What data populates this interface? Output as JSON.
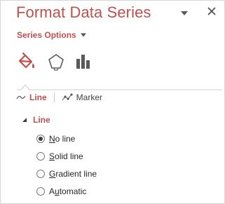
{
  "pane": {
    "title": "Format Data Series",
    "dropdown_icon": "chevron-down-icon",
    "close_icon": "close-icon"
  },
  "series_options": {
    "label": "Series Options",
    "caret_icon": "caret-down-icon"
  },
  "category_icons": [
    {
      "name": "fill-line",
      "icon": "paint-bucket-icon",
      "selected": true
    },
    {
      "name": "effects",
      "icon": "pentagon-icon",
      "selected": false
    },
    {
      "name": "series-options",
      "icon": "bar-chart-icon",
      "selected": false
    }
  ],
  "subtabs": {
    "line_label": "Line",
    "line_icon": "line-icon",
    "marker_label": "Marker",
    "marker_icon": "marker-line-icon",
    "active": "Line"
  },
  "section": {
    "label": "Line",
    "collapse_icon": "triangle-expanded-icon"
  },
  "radio_options": [
    {
      "prefix": "",
      "accel": "N",
      "rest": "o line",
      "checked": true
    },
    {
      "prefix": "",
      "accel": "S",
      "rest": "olid line",
      "checked": false
    },
    {
      "prefix": "",
      "accel": "G",
      "rest": "radient line",
      "checked": false
    },
    {
      "prefix": "A",
      "accel": "u",
      "rest": "tomatic",
      "checked": false
    }
  ],
  "colors": {
    "accent": "#c0504d",
    "text": "#262626",
    "border": "#d6d6d6"
  }
}
